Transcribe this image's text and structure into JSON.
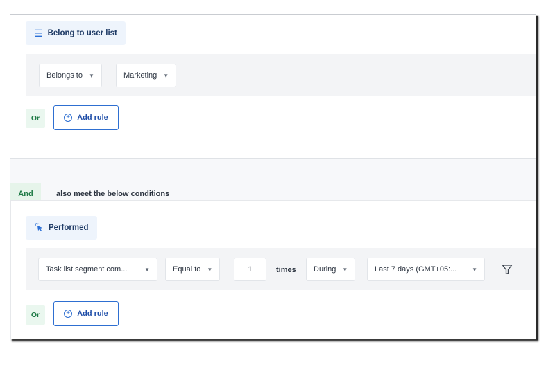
{
  "group1": {
    "chip_label": "Belong to user list",
    "chip_icon": "list-icon",
    "dropdowns": [
      {
        "label": "Belongs to"
      },
      {
        "label": "Marketing"
      }
    ],
    "or_label": "Or",
    "add_rule_label": "Add rule"
  },
  "connector": {
    "and_label": "And",
    "text": "also meet the below conditions"
  },
  "group2": {
    "chip_label": "Performed",
    "chip_icon": "cursor-click-icon",
    "event_dropdown": "Task list segment com...",
    "operator_dropdown": "Equal to",
    "count_value": "1",
    "times_label": "times",
    "period_dropdown": "During",
    "range_dropdown": "Last 7 days (GMT+05:...",
    "filter_icon": "filter-icon",
    "or_label": "Or",
    "add_rule_label": "Add rule"
  },
  "colors": {
    "accent": "#2e6fd1",
    "chip_bg": "#eef4fc",
    "and_bg": "#e6f4ea",
    "and_text": "#1e7a45"
  }
}
